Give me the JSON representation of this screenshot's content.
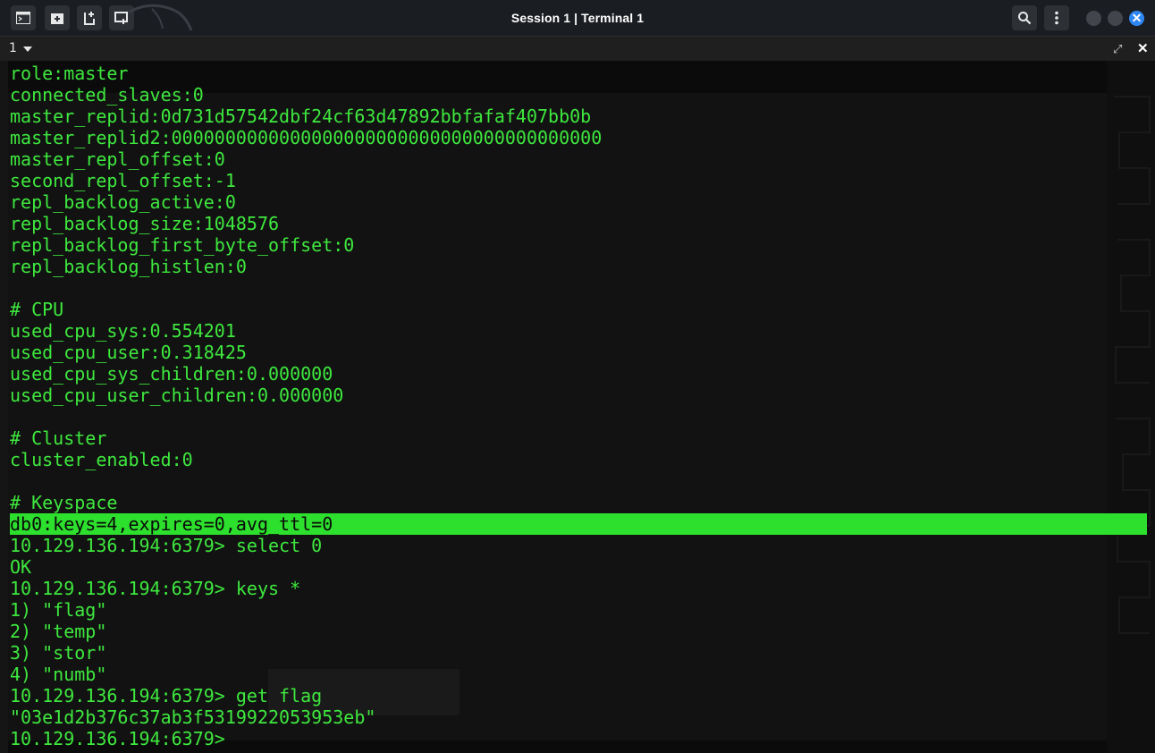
{
  "window": {
    "title": "Session 1 | Terminal 1",
    "toolbar_icons": [
      "terminal-menu-icon",
      "new-tab-icon",
      "split-terminal-icon",
      "new-window-icon"
    ],
    "right_icons": [
      "search-icon",
      "kebab-menu-icon"
    ],
    "window_controls": [
      "minimize",
      "maximize",
      "close"
    ],
    "close_glyph": "✕"
  },
  "tabbar": {
    "selected_tab": "1",
    "maximize_glyph": "⤢",
    "close_glyph": "✕"
  },
  "terminal": {
    "text_color": "#3ee83e",
    "highlight_color": "#2ee02e",
    "lines": [
      "role:master",
      "connected_slaves:0",
      "master_replid:0d731d57542dbf24cf63d47892bbfafaf407bb0b",
      "master_replid2:0000000000000000000000000000000000000000",
      "master_repl_offset:0",
      "second_repl_offset:-1",
      "repl_backlog_active:0",
      "repl_backlog_size:1048576",
      "repl_backlog_first_byte_offset:0",
      "repl_backlog_histlen:0",
      "",
      "# CPU",
      "used_cpu_sys:0.554201",
      "used_cpu_user:0.318425",
      "used_cpu_sys_children:0.000000",
      "used_cpu_user_children:0.000000",
      "",
      "# Cluster",
      "cluster_enabled:0",
      "",
      "# Keyspace",
      "db0:keys=4,expires=0,avg_ttl=0",
      "10.129.136.194:6379> select 0",
      "OK",
      "10.129.136.194:6379> keys *",
      "1) \"flag\"",
      "2) \"temp\"",
      "3) \"stor\"",
      "4) \"numb\"",
      "10.129.136.194:6379> get flag",
      "\"03e1d2b376c37ab3f5319922053953eb\"",
      "10.129.136.194:6379> "
    ],
    "highlighted_line": 21
  }
}
